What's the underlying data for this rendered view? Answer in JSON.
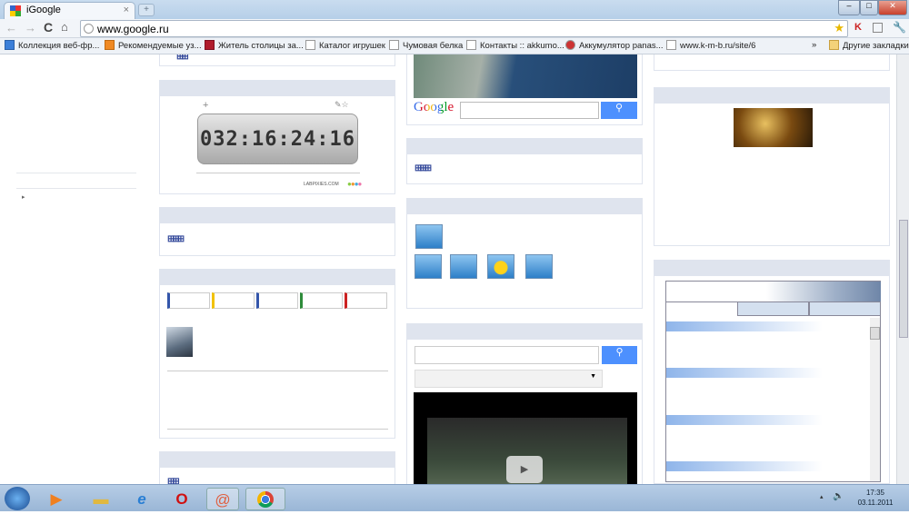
{
  "browser": {
    "tab_title": "iGoogle",
    "url": "www.google.ru",
    "bookmarks": [
      "Коллекция веб-фр...",
      "Рекомендуемые уз...",
      "Житель столицы за...",
      "Каталог игрушек",
      "Чумовая белка",
      "Контакты :: akkumo...",
      "Аккумулятор panas...",
      "www.k-m-b.ru/site/6"
    ],
    "overflow": "»",
    "other_bookmarks": "Другие закладки"
  },
  "countdown": {
    "value": "032:16:24:16",
    "credit": "LABPIXIES.COM"
  },
  "map_widget": {
    "logo": "Google"
  },
  "taskbar": {
    "time": "17:35",
    "date": "03.11.2011"
  },
  "colors": {
    "widget_header": "#dfe4ee",
    "search_button": "#4d90fe",
    "tab_colors": [
      "#3355aa",
      "#f2c200",
      "#3355aa",
      "#2e8b3a",
      "#cc2222"
    ]
  }
}
